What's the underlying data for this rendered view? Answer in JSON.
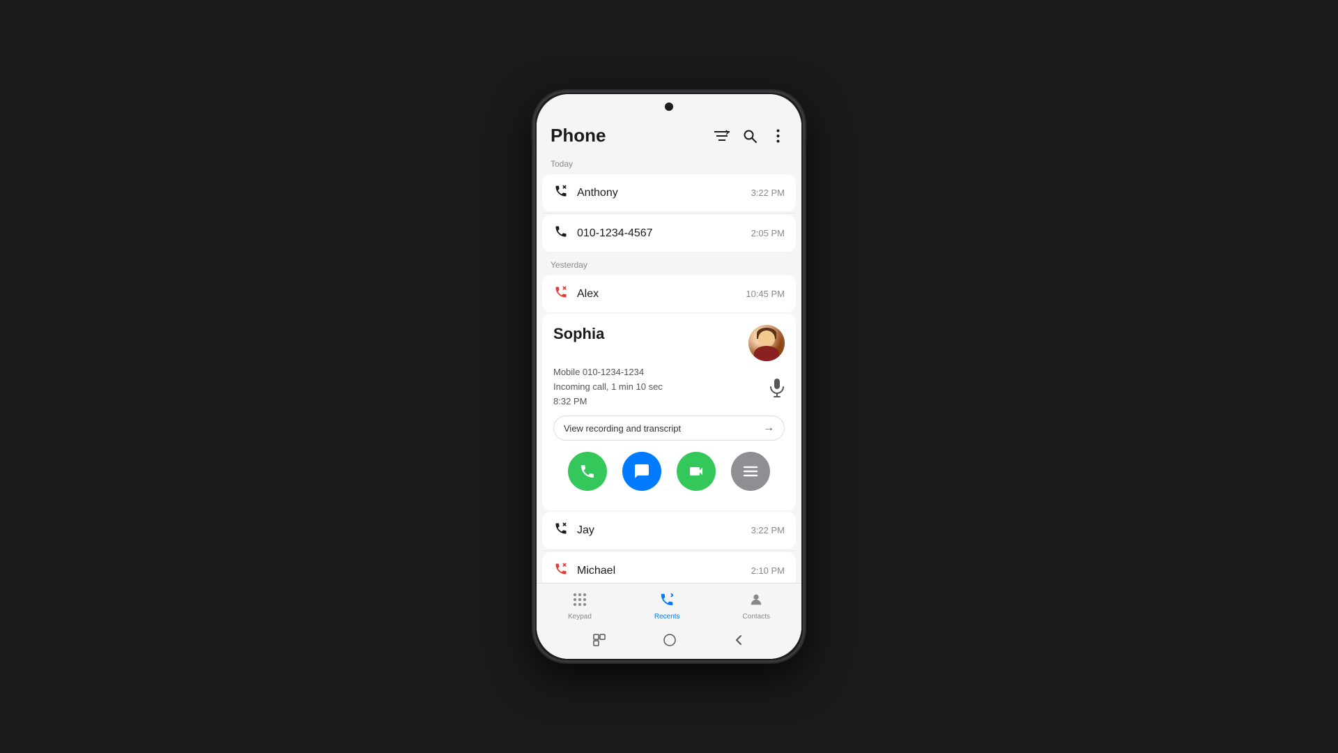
{
  "page": {
    "background": "#1a1a1a"
  },
  "header": {
    "title": "Phone",
    "filter_icon": "≡↑",
    "search_icon": "🔍",
    "more_icon": "⋮"
  },
  "sections": [
    {
      "label": "Today",
      "calls": [
        {
          "name": "Anthony",
          "time": "3:22 PM",
          "type": "outgoing",
          "missed": false
        },
        {
          "name": "010-1234-4567",
          "time": "2:05 PM",
          "type": "incoming",
          "missed": false
        }
      ]
    },
    {
      "label": "Yesterday",
      "calls": [
        {
          "name": "Alex",
          "time": "10:45 PM",
          "type": "missed",
          "missed": true
        }
      ]
    }
  ],
  "expanded_contact": {
    "name": "Sophia",
    "number_label": "Mobile 010-1234-1234",
    "call_info": "Incoming call, 1 min 10 sec",
    "time": "8:32 PM",
    "recording_label": "View recording and transcript",
    "has_avatar": true
  },
  "action_buttons": [
    {
      "name": "call",
      "label": "phone-button",
      "icon": "📞",
      "color": "#34c759"
    },
    {
      "name": "message",
      "label": "message-button",
      "icon": "💬",
      "color": "#007aff"
    },
    {
      "name": "video",
      "label": "video-button",
      "icon": "🎥",
      "color": "#34c759"
    },
    {
      "name": "details",
      "label": "details-button",
      "icon": "☰",
      "color": "#8e8e93"
    }
  ],
  "more_calls": [
    {
      "name": "Jay",
      "time": "3:22 PM",
      "type": "outgoing",
      "missed": false
    },
    {
      "name": "Michael",
      "time": "2:10 PM",
      "type": "missed",
      "missed": true
    }
  ],
  "bottom_nav": [
    {
      "id": "keypad",
      "label": "Keypad",
      "active": false
    },
    {
      "id": "recents",
      "label": "Recents",
      "active": true
    },
    {
      "id": "contacts",
      "label": "Contacts",
      "active": false
    }
  ],
  "system_bar": {
    "back": "❮",
    "home": "○",
    "recents": "|||"
  }
}
